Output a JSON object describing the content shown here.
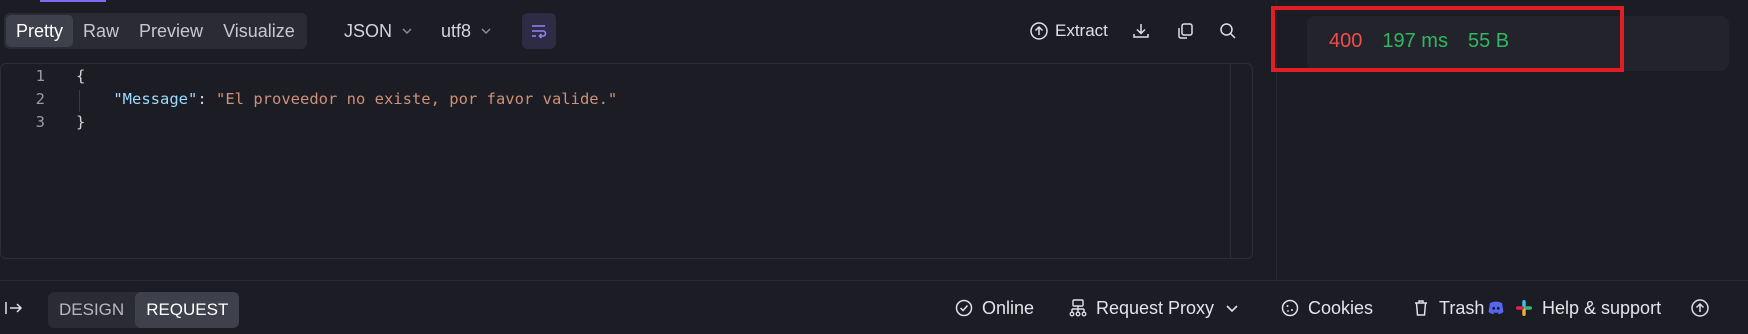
{
  "view_tabs": [
    "Pretty",
    "Raw",
    "Preview",
    "Visualize"
  ],
  "active_view_tab": "Pretty",
  "format_dropdown": "JSON",
  "encoding_dropdown": "utf8",
  "toolbar": {
    "extract_label": "Extract"
  },
  "editor": {
    "line_numbers": [
      "1",
      "2",
      "3"
    ],
    "line1": "{",
    "line2_indent": "    ",
    "line2_key": "\"Message\"",
    "line2_sep": ": ",
    "line2_value": "\"El proveedor no existe, por favor valide.\"",
    "line3": "}"
  },
  "status": {
    "code": "400",
    "time": "197 ms",
    "size": "55 B"
  },
  "footer": {
    "modes": [
      "DESIGN",
      "REQUEST"
    ],
    "active_mode": "REQUEST",
    "online_label": "Online",
    "proxy_label": "Request Proxy",
    "cookies_label": "Cookies",
    "trash_label": "Trash",
    "help_label": "Help & support"
  },
  "colors": {
    "status_error": "#f14c4c",
    "status_ok": "#2fb862",
    "accent": "#7c6cf0",
    "highlight": "#e01e24"
  }
}
